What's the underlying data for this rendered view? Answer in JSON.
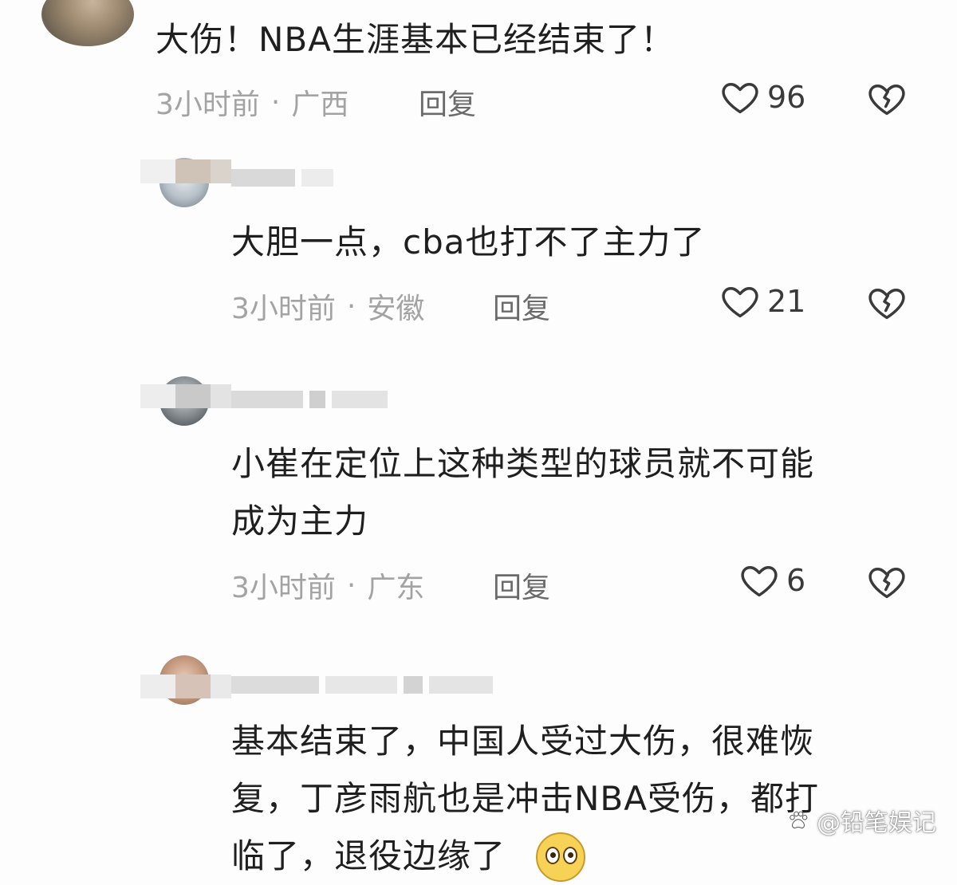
{
  "comments": [
    {
      "text": "大伤！NBA生涯基本已经结束了！",
      "time": "3小时前",
      "separator": "·",
      "location": "广西",
      "reply_label": "回复",
      "likes": "96"
    },
    {
      "text": "大胆一点，cba也打不了主力了",
      "time": "3小时前",
      "separator": "·",
      "location": "安徽",
      "reply_label": "回复",
      "likes": "21"
    },
    {
      "text_line1": "小崔在定位上这种类型的球员就不可能",
      "text_line2": "成为主力",
      "time": "3小时前",
      "separator": "·",
      "location": "广东",
      "reply_label": "回复",
      "likes": "6"
    },
    {
      "text_line1": "基本结束了，中国人受过大伤，很难恢",
      "text_line2": "复，丁彦雨航也是冲击NBA受伤，都打",
      "text_line3": "临了，退役边缘了"
    }
  ],
  "icons": {
    "like": "heart-outline-icon",
    "dislike": "broken-heart-icon",
    "emoji": "astonished-face-emoji"
  },
  "colors": {
    "text": "#1f1f1f",
    "meta": "#a3a3a3",
    "reply": "#6b6b6b",
    "background": "#fdfdfd"
  },
  "watermark": {
    "text": "@铅笔娱记"
  }
}
